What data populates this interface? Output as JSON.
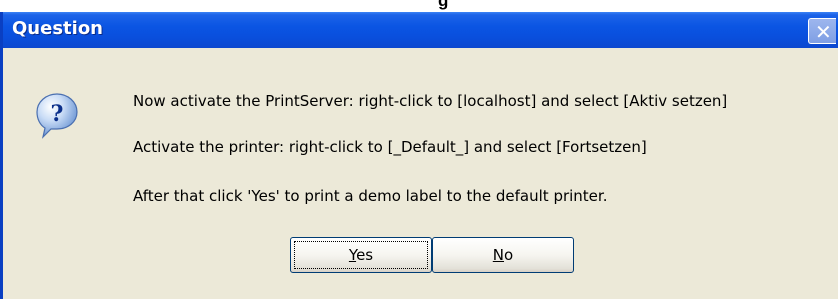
{
  "header_fragment": "g",
  "dialog": {
    "title": "Question",
    "close_symbol": "✕",
    "icon": "question-icon",
    "icon_glyph": "?",
    "messages": [
      "Now activate the PrintServer: right-click to [localhost] and select [Aktiv setzen]",
      "Activate the printer: right-click to [_Default_] and select [Fortsetzen]",
      "After that click 'Yes' to print a demo label to the default printer."
    ],
    "buttons": {
      "yes": {
        "mnemonic": "Y",
        "rest": "es"
      },
      "no": {
        "mnemonic": "N",
        "rest": "o"
      }
    }
  },
  "colors": {
    "titlebar": "#0a4fdd",
    "body": "#ece9d8",
    "button_border": "#003c74"
  }
}
